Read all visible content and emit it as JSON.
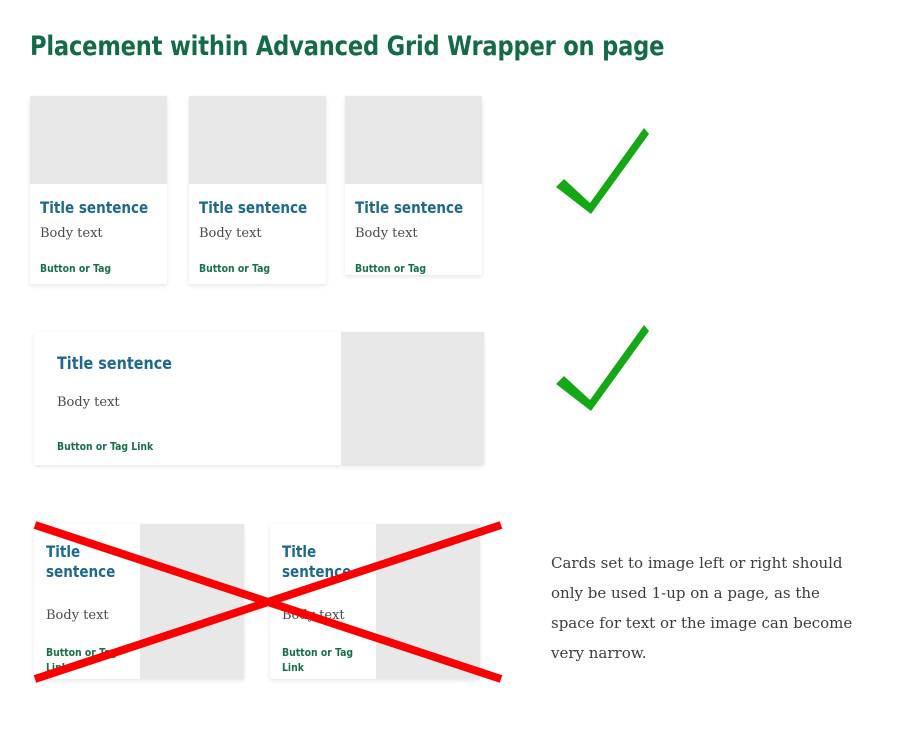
{
  "page": {
    "title": "Placement within Advanced Grid Wrapper on page",
    "background": "#ffffff",
    "heading_color": "#146B47"
  },
  "colors": {
    "heading_green": "#146B47",
    "card_title_blue": "#1F6A8C",
    "card_body_gray": "#4A4A4A",
    "card_link_green": "#18704A",
    "image_placeholder_gray": "#E8E8E8",
    "approve_check_green": "#15A815",
    "reject_cross_red": "#FB0000"
  },
  "rows": [
    {
      "name": "three-up-image-top",
      "verdict": "approved",
      "mark": "check-mark-icon",
      "cards": [
        {
          "title": "Title sentence",
          "body": "Body text",
          "link": "Button or Tag",
          "image": "image-placeholder"
        },
        {
          "title": "Title sentence",
          "body": "Body text",
          "link": "Button or Tag",
          "image": "image-placeholder"
        },
        {
          "title": "Title sentence",
          "body": "Body text",
          "link": "Button or Tag",
          "image": "image-placeholder"
        }
      ]
    },
    {
      "name": "one-up-image-right",
      "verdict": "approved",
      "mark": "check-mark-icon",
      "cards": [
        {
          "title": "Title sentence",
          "body": "Body text",
          "link": "Button or Tag Link",
          "image": "image-placeholder"
        }
      ]
    },
    {
      "name": "two-up-image-right",
      "verdict": "rejected",
      "mark": "cross-mark-icon",
      "cards": [
        {
          "title": "Title sentence",
          "body": "Body text",
          "link": "Button or Tag Link",
          "image": "image-placeholder"
        },
        {
          "title": "Title sentence",
          "body": "Body text",
          "link": "Button or Tag Link",
          "image": "image-placeholder"
        }
      ]
    }
  ],
  "note": "Cards set to image left or right should only be used 1-up on a page, as the space for text or the image can become very narrow."
}
